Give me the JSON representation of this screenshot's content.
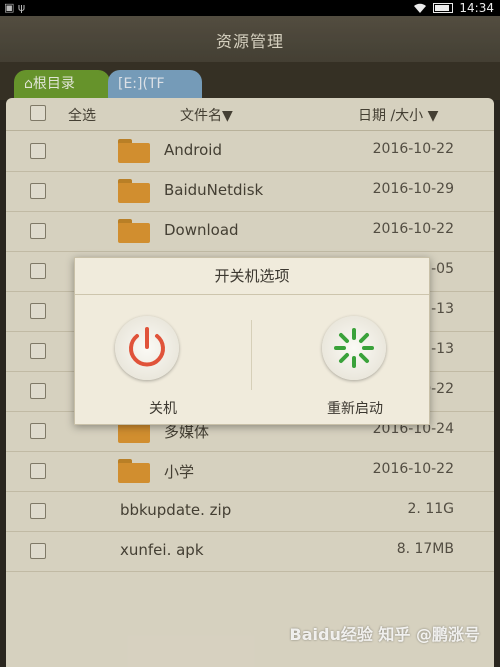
{
  "status": {
    "time": "14:34"
  },
  "title": "资源管理",
  "tabs": [
    {
      "label": "根目录"
    },
    {
      "label": "[E:](TF存…"
    }
  ],
  "header": {
    "select_all": "全选",
    "filename": "文件名",
    "date_size": "日期 /大小"
  },
  "files": [
    {
      "name": "Android",
      "date": "2016-10-22",
      "type": "folder"
    },
    {
      "name": "BaiduNetdisk",
      "date": "2016-10-29",
      "type": "folder"
    },
    {
      "name": "Download",
      "date": "2016-10-22",
      "type": "folder"
    },
    {
      "name": "",
      "date": "1-05",
      "type": "folder"
    },
    {
      "name": "",
      "date": "1-13",
      "type": "folder"
    },
    {
      "name": "",
      "date": "1-13",
      "type": "folder"
    },
    {
      "name": "",
      "date": "0-22",
      "type": "folder"
    },
    {
      "name": "多媒体",
      "date": "2016-10-24",
      "type": "folder"
    },
    {
      "name": "小学",
      "date": "2016-10-22",
      "type": "folder"
    },
    {
      "name": "bbkupdate. zip",
      "date": "2. 11G",
      "type": "file"
    },
    {
      "name": "xunfei. apk",
      "date": "8. 17MB",
      "type": "file"
    }
  ],
  "dialog": {
    "title": "开关机选项",
    "shutdown_label": "关机",
    "restart_label": "重新启动"
  },
  "watermark": "Baidu经验 知乎 @鹏涨号",
  "colors": {
    "shutdown": "#e0533a",
    "restart": "#3aa23a",
    "tab_root": "#6fa02f",
    "tab_tf": "#7fa9c8"
  }
}
